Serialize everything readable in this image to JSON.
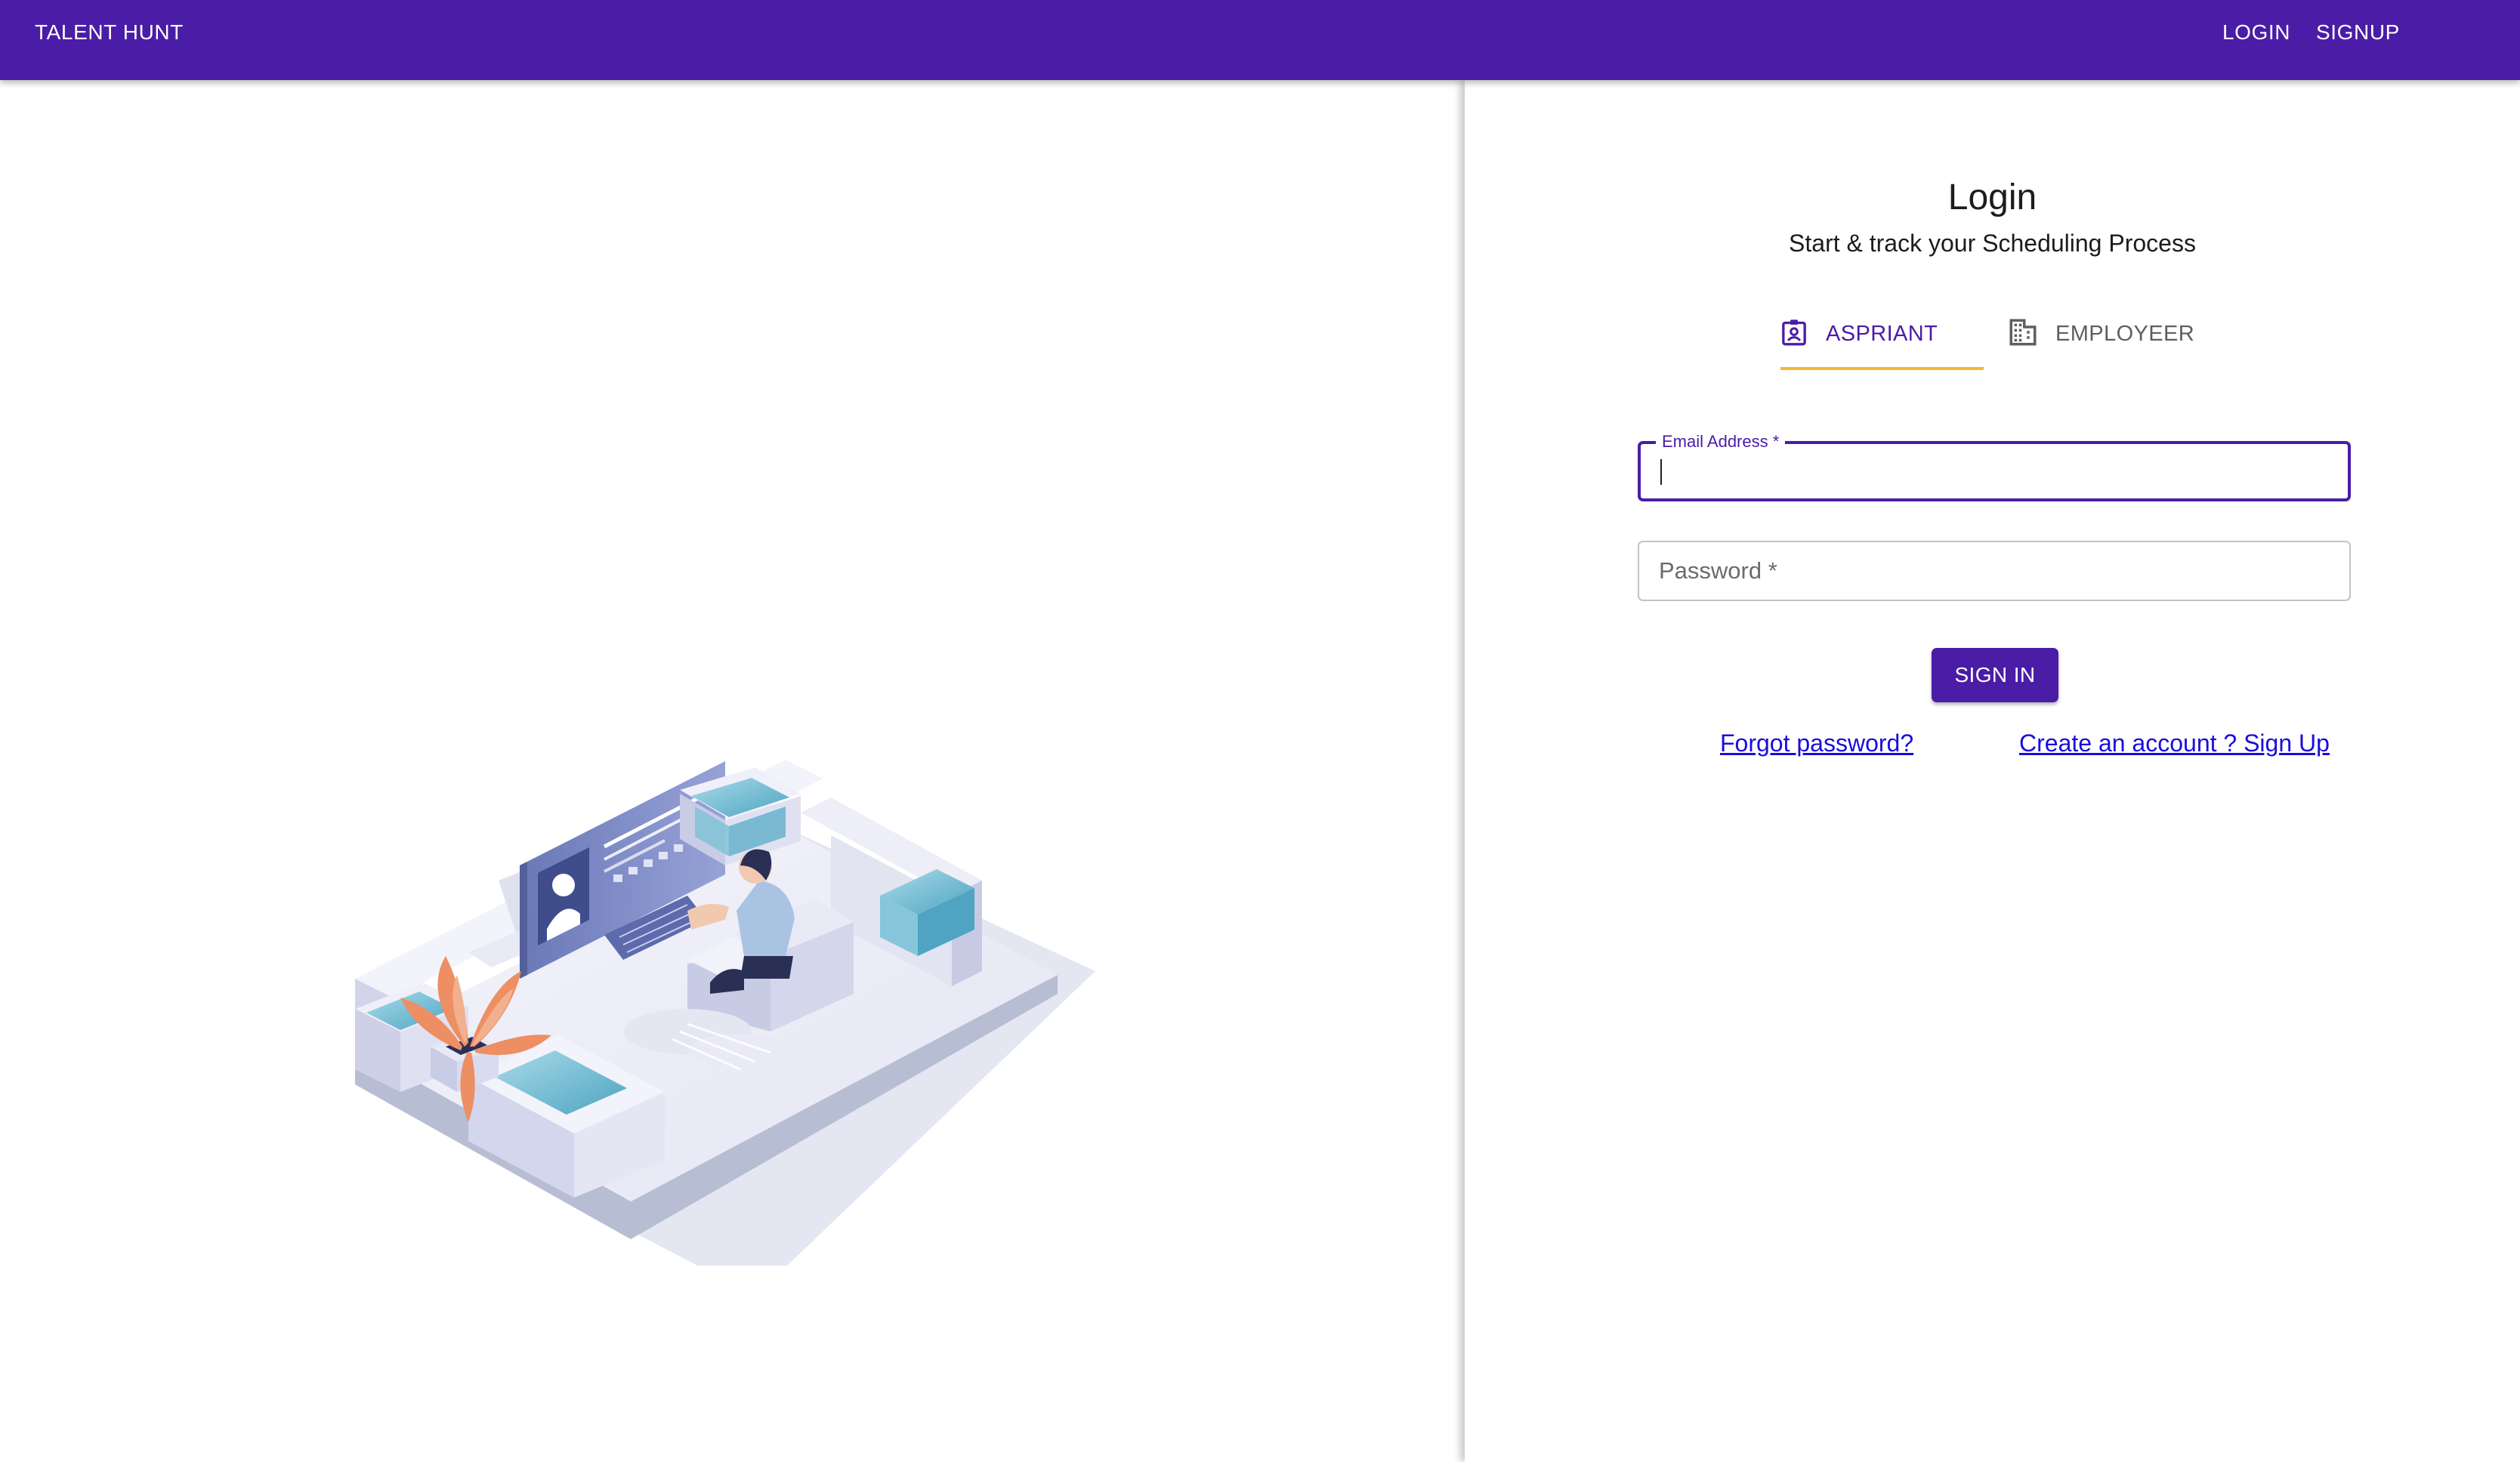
{
  "appbar": {
    "brand": "TALENT HUNT",
    "nav": {
      "login": "LOGIN",
      "signup": "SIGNUP"
    },
    "color": "#4b1ca6"
  },
  "illustration": {
    "name": "isometric-workspace-illustration"
  },
  "login": {
    "title": "Login",
    "subtitle": "Start & track your Scheduling Process",
    "tabs": [
      {
        "label": "ASPRIANT",
        "icon": "badge-icon",
        "selected": true
      },
      {
        "label": "EMPLOYEER",
        "icon": "building-icon",
        "selected": false
      }
    ],
    "email": {
      "label": "Email Address *",
      "value": ""
    },
    "password": {
      "placeholder": "Password *",
      "value": ""
    },
    "submit_label": "SIGN IN",
    "links": {
      "forgot": "Forgot password?",
      "signup": "Create an account ? Sign Up"
    },
    "accent": "#4b1ca6",
    "tab_indicator_color": "#f5b82e",
    "link_color": "#1a0ddb"
  }
}
